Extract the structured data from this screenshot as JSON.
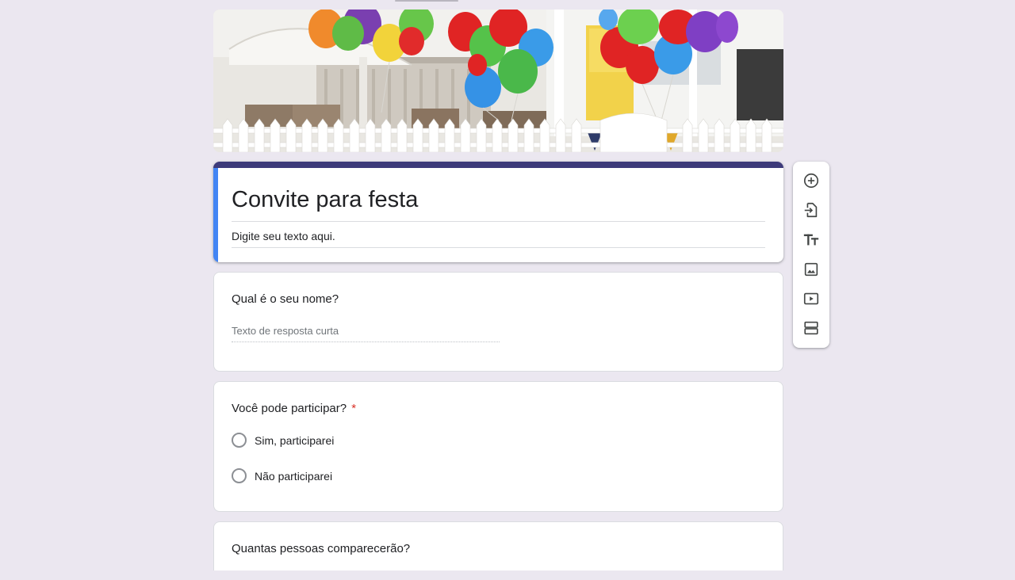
{
  "form": {
    "title": "Convite para festa",
    "description": "Digite seu texto aqui."
  },
  "questions": [
    {
      "title": "Qual é o seu nome?",
      "type": "short-answer",
      "placeholder": "Texto de resposta curta",
      "required": false
    },
    {
      "title": "Você pode participar?",
      "type": "multiple-choice",
      "required": true,
      "required_mark": "*",
      "options": [
        "Sim, participarei",
        "Não participarei"
      ]
    },
    {
      "title": "Quantas pessoas comparecerão?",
      "type": "unknown",
      "required": false
    }
  ],
  "toolbar": {
    "items": [
      {
        "icon": "add-circle-icon"
      },
      {
        "icon": "import-questions-icon"
      },
      {
        "icon": "title-text-icon"
      },
      {
        "icon": "image-icon"
      },
      {
        "icon": "video-icon"
      },
      {
        "icon": "section-icon"
      }
    ]
  },
  "colors": {
    "background": "#ebe7f0",
    "title_bar": "#3d3a7a",
    "accent_bar": "#4285f4",
    "required": "#d93025"
  }
}
